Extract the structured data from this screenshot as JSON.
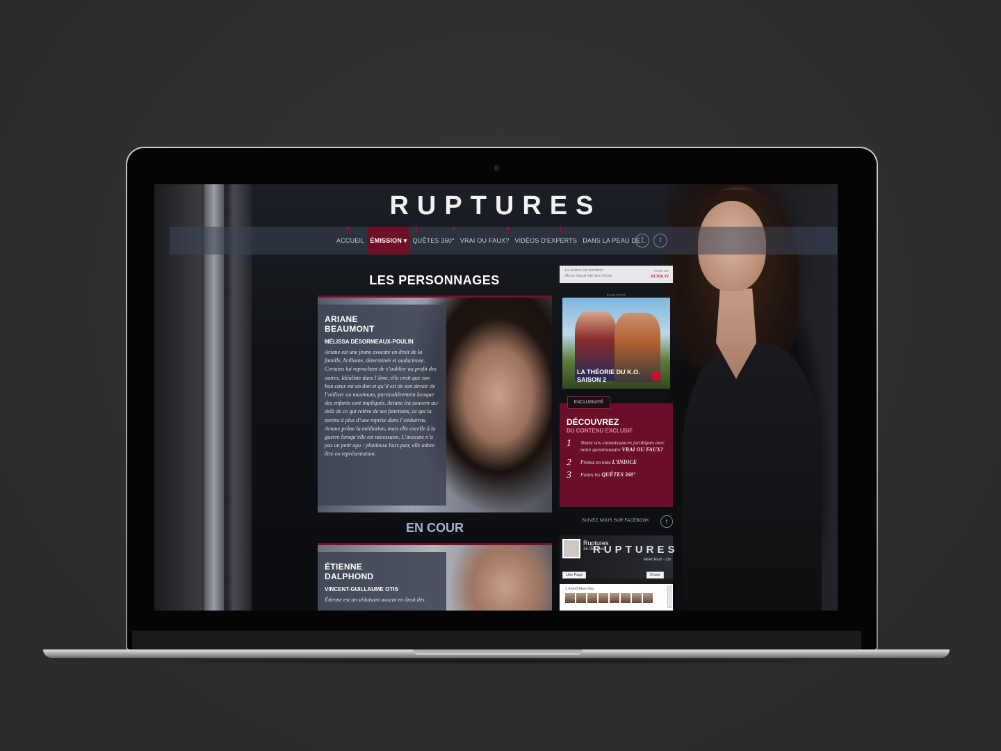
{
  "site": {
    "logo": "RUPTURES"
  },
  "nav": {
    "items": [
      {
        "label": "ACCUEIL",
        "active": false
      },
      {
        "label": "ÉMISSION ▾",
        "active": true
      },
      {
        "label": "QUÊTES 360°",
        "active": false
      },
      {
        "label": "VRAI OU FAUX?",
        "active": false
      },
      {
        "label": "VIDÉOS D'EXPERTS",
        "active": false
      },
      {
        "label": "DANS LA PEAU DE...",
        "active": false
      }
    ],
    "social": [
      "facebook-icon",
      "twitter-icon"
    ],
    "accent": "#6d0f26"
  },
  "main": {
    "section_title": "LES PERSONNAGES",
    "group_title": "EN COUR",
    "characters": [
      {
        "name_line1": "ARIANE",
        "name_line2": "BEAUMONT",
        "actor": "MÉLISSA DÉSORMEAUX-POULIN",
        "description": "Ariane est une jeune avocate en droit de la famille, brillante, déterminée et audacieuse. Certains lui reprochent de s’oublier au profit des autres. Idéaliste dans l’âme, elle croit que son bon cœur est un don et qu’il est de son devoir de l’utiliser au maximum, particulièrement lorsque des enfants sont impliqués. Ariane ira souvent au-delà de ce qui relève de ses fonctions, ce qui la mettra à plus d’une reprise dans l’embarras. Ariane prône la médiation, mais elle excelle à la guerre lorsqu’elle est nécessaire. L’avocate n’a pas un petit ego : plaideuse hors pair, elle adore être en représentation."
      },
      {
        "name_line1": "ÉTIENNE",
        "name_line2": "DALPHOND",
        "actor": "VINCENT-GUILLAUME OTIS",
        "description": "Étienne est un séduisant avocat en droit des"
      }
    ]
  },
  "sidebar": {
    "season": {
      "line1": "La saison est terminée",
      "line2": "Merci d'avoir été des nôtres",
      "watch_label": "revoir sur",
      "watch_brand": "ICI TOU.TV"
    },
    "ad": {
      "label": "PUBLICITÉ",
      "title_line1": "LA THÉORIE DU K.O.",
      "title_line2": "SAISON 2"
    },
    "exclusive": {
      "tab": "EXCLUSIVITÉ",
      "heading": "DÉCOUVREZ",
      "subheading": "DU CONTENU EXCLUSIF",
      "steps": [
        {
          "num": "1",
          "text": "Testez vos connaissances juridiques avec notre questionnaire",
          "bold": "VRAI OU FAUX?"
        },
        {
          "num": "2",
          "text": "Prenez en note",
          "bold": "L’INDICE"
        },
        {
          "num": "3",
          "text": "Faites les",
          "bold": "QUÊTES 360°"
        }
      ]
    },
    "facebook": {
      "follow_label": "SUIVEZ NOUS SUR FACEBOOK",
      "page_name": "Ruptures",
      "likes": "36 088 likes",
      "cover_logo": "RUPTURES",
      "cover_day": "MERCREDI - 21h",
      "like_button": "Like Page",
      "share_button": "Share",
      "friends_text": "1 friend likes this"
    }
  }
}
